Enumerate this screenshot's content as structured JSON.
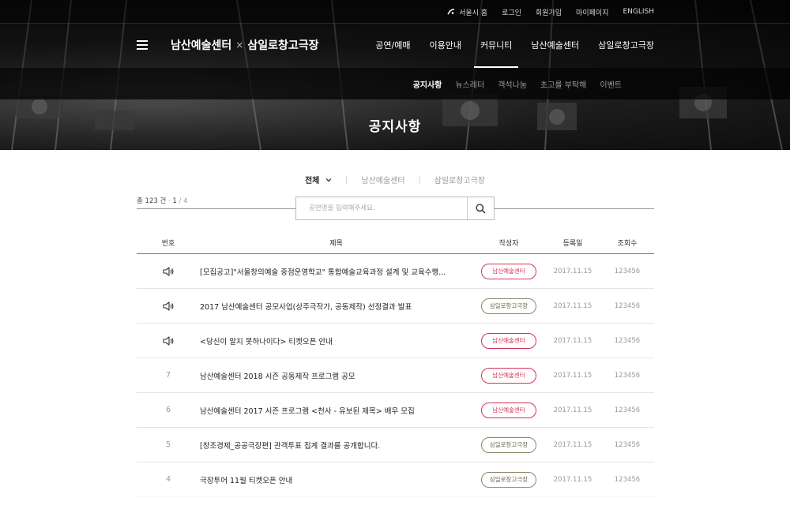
{
  "colors": {
    "accent_nam": "#d6315a",
    "accent_sam": "#8c8568",
    "header_bg": "#1a1a1a"
  },
  "utility_links": [
    {
      "label": "서울시 홈",
      "icon": "seoul-logo-icon"
    },
    {
      "label": "로그인"
    },
    {
      "label": "회원가입"
    },
    {
      "label": "마이페이지"
    },
    {
      "label": "ENGLISH"
    }
  ],
  "brand": {
    "left": "남산예술센터",
    "separator": "×",
    "right": "삼일로창고극장"
  },
  "gnb": [
    "공연/예매",
    "이용안내",
    "커뮤니티",
    "남산예술센터",
    "삼일로창고극장"
  ],
  "gnb_active": "커뮤니티",
  "snb": [
    "공지사항",
    "뉴스레터",
    "객석나눔",
    "초고를 부탁해",
    "이벤트"
  ],
  "snb_active": "공지사항",
  "page_title": "공지사항",
  "filter": {
    "tabs": [
      "전체",
      "남산예술센터",
      "삼일로창고극장"
    ],
    "active": "전체"
  },
  "count": {
    "prefix": "총",
    "total": "123",
    "unit": "건",
    "dot": "·",
    "page": "1",
    "pages": "/ 4"
  },
  "search": {
    "placeholder": "공연명을 입력해주세요.",
    "icon": "search-icon"
  },
  "table": {
    "headers": {
      "no": "번호",
      "title": "제목",
      "author": "작성자",
      "date": "등록일",
      "views": "조회수"
    },
    "rows": [
      {
        "notice": true,
        "no": "",
        "title": "[모집공고]\"서울창의예술 중점운영학교\" 통합예술교육과정 설계 및 교육수행...",
        "author": "남산예술센터",
        "author_type": "nam",
        "date": "2017.11.15",
        "views": "123456"
      },
      {
        "notice": true,
        "no": "",
        "title": "2017 남산예술센터 공모사업(상주극작가, 공동제작) 선정결과 발표",
        "author": "삼일로창고극장",
        "author_type": "sam",
        "date": "2017.11.15",
        "views": "123456"
      },
      {
        "notice": true,
        "no": "",
        "title": "<당신이 알지 못하나이다> 티켓오픈 안내",
        "author": "남산예술센터",
        "author_type": "nam",
        "date": "2017.11.15",
        "views": "123456"
      },
      {
        "notice": false,
        "no": "7",
        "title": "남산예술센터 2018 시즌 공동제작 프로그램 공모",
        "author": "남산예술센터",
        "author_type": "nam",
        "date": "2017.11.15",
        "views": "123456"
      },
      {
        "notice": false,
        "no": "6",
        "title": "남산예술센터 2017 시즌 프로그램 <천사 - 유보된 제목> 배우 모집",
        "author": "남산예술센터",
        "author_type": "nam",
        "date": "2017.11.15",
        "views": "123456"
      },
      {
        "notice": false,
        "no": "5",
        "title": "[창조경제_공공극장편] 관객투표 집계 결과를 공개합니다.",
        "author": "삼일로창고극장",
        "author_type": "sam",
        "date": "2017.11.15",
        "views": "123456"
      },
      {
        "notice": false,
        "no": "4",
        "title": "극장투어 11월 티켓오픈 안내",
        "author": "삼일로창고극장",
        "author_type": "sam",
        "date": "2017.11.15",
        "views": "123456"
      }
    ]
  }
}
